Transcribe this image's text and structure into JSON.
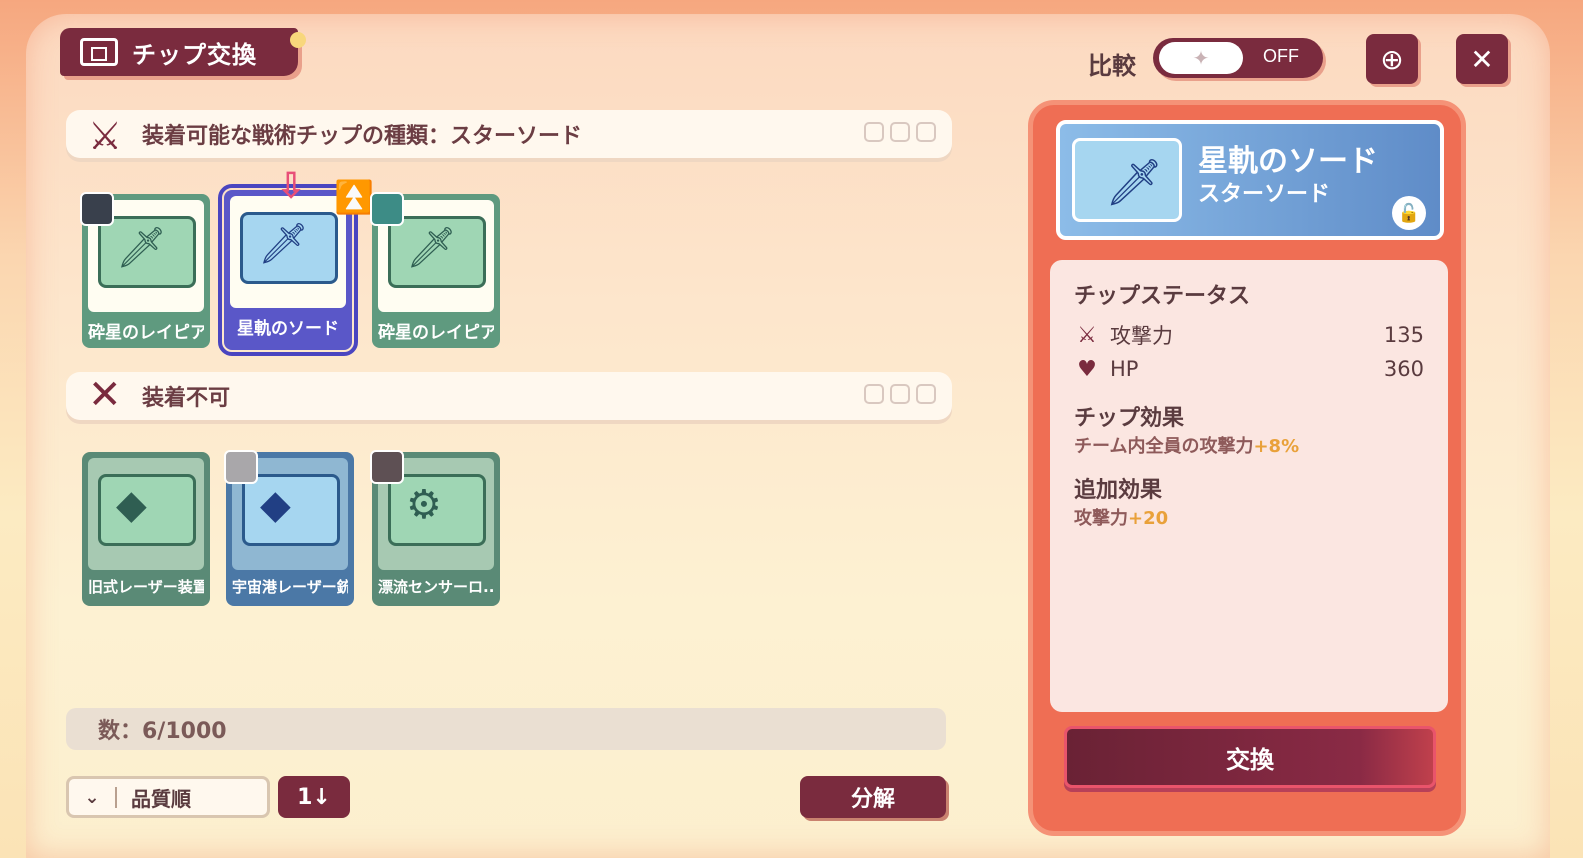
{
  "header": {
    "title": "チップ交換",
    "compare_label": "比較",
    "compare_toggle_state": "OFF"
  },
  "equippable_section": {
    "title": "装着可能な戦術チップの種類：スターソード",
    "cards": [
      {
        "label": "砕星のレイピア"
      },
      {
        "label": "星軌のソード"
      },
      {
        "label": "砕星のレイピア"
      }
    ]
  },
  "unequippable_section": {
    "title": "装着不可",
    "cards": [
      {
        "label": "旧式レーザー装置"
      },
      {
        "label": "宇宙港レーザー銃"
      },
      {
        "label": "漂流センサーロ..."
      }
    ]
  },
  "footer": {
    "count": "数：6/1000",
    "sort_value": "品質順",
    "order_label": "1↓",
    "decompose_label": "分解"
  },
  "detail_panel": {
    "name": "星軌のソード",
    "type": "スターソード",
    "status_title": "チップステータス",
    "stats": [
      {
        "label": "攻撃力",
        "value": "135"
      },
      {
        "label": "HP",
        "value": "360"
      }
    ],
    "effect_title": "チップ効果",
    "effect_text": "チーム内全員の攻撃力",
    "effect_value": "+8%",
    "extra_title": "追加効果",
    "extra_text": "攻撃力",
    "extra_value": "+20",
    "exchange_label": "交換"
  }
}
